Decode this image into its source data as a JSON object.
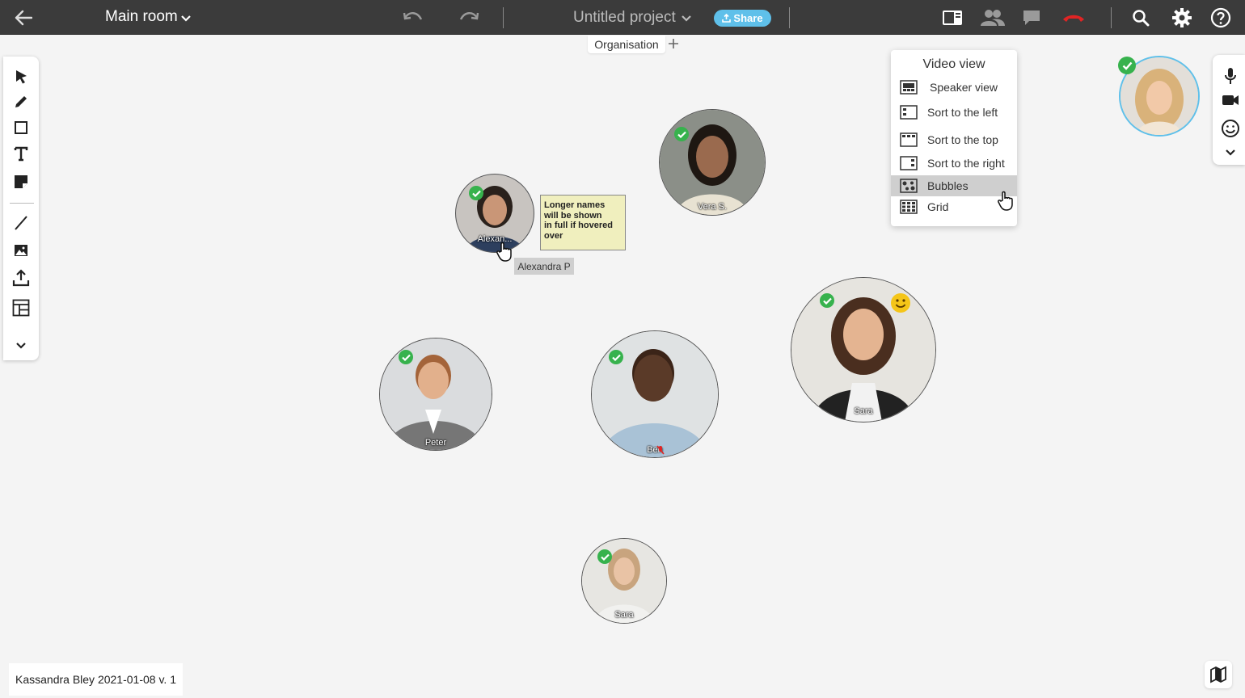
{
  "topbar": {
    "room_label": "Main room",
    "project_title": "Untitled project",
    "share_label": "Share"
  },
  "tabs": {
    "active": "Organisation"
  },
  "video_view_menu": {
    "title": "Video view",
    "items": [
      {
        "label": "Speaker view"
      },
      {
        "label": "Sort to the left"
      },
      {
        "label": "Sort to the top"
      },
      {
        "label": "Sort to the right"
      },
      {
        "label": "Bubbles",
        "selected": true
      },
      {
        "label": "Grid"
      }
    ]
  },
  "participants": {
    "alexandra": {
      "short": "Alexan...",
      "full": "Alexandra P"
    },
    "vera": {
      "name": "Vera S."
    },
    "peter": {
      "name": "Peter"
    },
    "ben": {
      "name": "Ben"
    },
    "sara_large": {
      "name": "Sara"
    },
    "sara_small": {
      "name": "Sara"
    }
  },
  "sticky_note": {
    "text": "Longer names\nwill be shown\n in full if hovered\n over"
  },
  "footer": {
    "version_label": "Kassandra Bley 2021-01-08 v. 1"
  },
  "colors": {
    "topbar": "#3b3b3b",
    "share": "#5fc0ea",
    "check": "#37b24d",
    "hangup": "#e02424",
    "canvas": "#f4f4f4"
  }
}
